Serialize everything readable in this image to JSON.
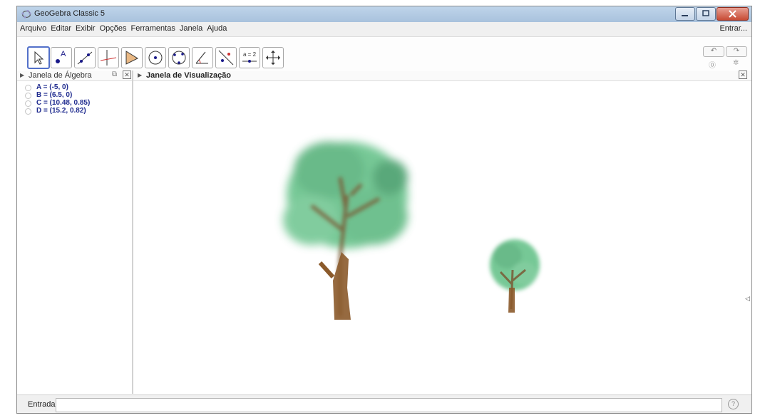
{
  "window": {
    "title": "GeoGebra Classic 5"
  },
  "menu": {
    "items": [
      "Arquivo",
      "Editar",
      "Exibir",
      "Opções",
      "Ferramentas",
      "Janela",
      "Ajuda"
    ],
    "login_label": "Entrar..."
  },
  "toolbar": {
    "tools": [
      {
        "name": "move-tool",
        "icon": "arrow-cursor-icon"
      },
      {
        "name": "point-tool",
        "icon": "point-A-icon"
      },
      {
        "name": "line-tool",
        "icon": "line-icon"
      },
      {
        "name": "perpendicular-line-tool",
        "icon": "perpendicular-icon"
      },
      {
        "name": "polygon-tool",
        "icon": "polygon-icon"
      },
      {
        "name": "circle-center-point-tool",
        "icon": "circle-icon"
      },
      {
        "name": "circle-three-points-tool",
        "icon": "circle-three-points-icon"
      },
      {
        "name": "angle-tool",
        "icon": "angle-icon"
      },
      {
        "name": "reflect-tool",
        "icon": "reflect-line-icon"
      },
      {
        "name": "slider-tool",
        "icon": "slider-icon",
        "label": "a = 2"
      },
      {
        "name": "move-graphics-view-tool",
        "icon": "move-cross-icon"
      }
    ]
  },
  "algebra": {
    "title": "Janela de Álgebra",
    "items": [
      {
        "label": "A = (-5, 0)"
      },
      {
        "label": "B = (6.5, 0)"
      },
      {
        "label": "C = (10.48, 0.85)"
      },
      {
        "label": "D = (15.2, 0.82)"
      }
    ]
  },
  "graphics": {
    "title": "Janela de Visualização"
  },
  "input_bar": {
    "label": "Entrada:",
    "value": ""
  },
  "colors": {
    "point_text": "#1f2b8f",
    "tree_leaves": "#4caf73",
    "tree_trunk": "#8b5a2b"
  }
}
